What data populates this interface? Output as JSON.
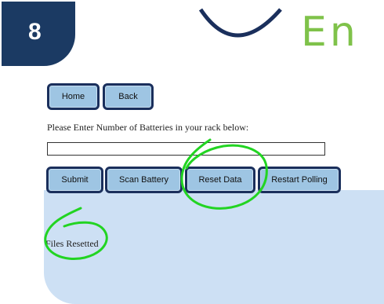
{
  "step_badge": {
    "number": "8"
  },
  "logo": {
    "partial_text": "En"
  },
  "nav": {
    "home_label": "Home",
    "back_label": "Back"
  },
  "form": {
    "prompt": "Please Enter Number of Batteries in your rack below:",
    "batteries_input_value": ""
  },
  "actions": {
    "submit_label": "Submit",
    "scan_label": "Scan Battery",
    "reset_label": "Reset Data",
    "restart_label": "Restart Polling"
  },
  "status": {
    "message": "Files Resetted"
  },
  "colors": {
    "badge": "#1b3a63",
    "button_fill": "#9ec5e3",
    "button_border": "#1a2f5c",
    "panel_bg": "#cde0f4",
    "annotation": "#22d422",
    "logo_green": "#7fc24a"
  }
}
